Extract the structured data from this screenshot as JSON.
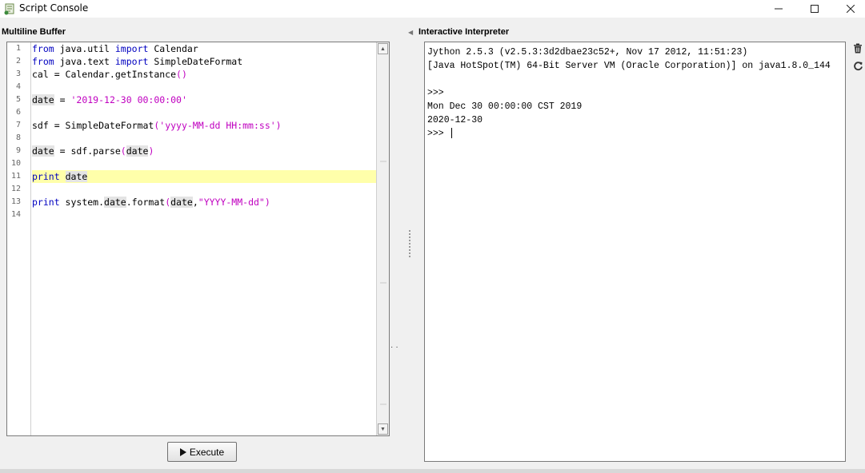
{
  "window": {
    "title": "Script Console",
    "icon": "script-console-icon"
  },
  "left_panel": {
    "header": "Multiline Buffer",
    "execute_label": "Execute",
    "current_line": 11,
    "lines": [
      {
        "num": "1",
        "text": ""
      },
      {
        "num": "2",
        "text": ""
      },
      {
        "num": "3",
        "text": ""
      },
      {
        "num": "4",
        "text": ""
      },
      {
        "num": "5",
        "text": ""
      },
      {
        "num": "6",
        "text": ""
      },
      {
        "num": "7",
        "text": ""
      },
      {
        "num": "8",
        "text": ""
      },
      {
        "num": "9",
        "text": ""
      },
      {
        "num": "10",
        "text": ""
      },
      {
        "num": "11",
        "text": ""
      },
      {
        "num": "12",
        "text": ""
      },
      {
        "num": "13",
        "text": ""
      },
      {
        "num": "14",
        "text": ""
      }
    ],
    "code": {
      "l1_kw1": "from",
      "l1_mod": " java.util ",
      "l1_kw2": "import",
      "l1_name": " Calendar",
      "l2_kw1": "from",
      "l2_mod": " java.text ",
      "l2_kw2": "import",
      "l2_name": " SimpleDateFormat",
      "l3_text": "cal = Calendar.getInstance",
      "l3_paren": "()",
      "l5_var": "date",
      "l5_eq": " = ",
      "l5_str": "'2019-12-30 00:00:00'",
      "l7_text": "sdf = SimpleDateFormat",
      "l7_open": "(",
      "l7_str": "'yyyy-MM-dd HH:mm:ss'",
      "l7_close": ")",
      "l9_var": "date",
      "l9_text": " = sdf.parse",
      "l9_open": "(",
      "l9_arg": "date",
      "l9_close": ")",
      "l11_kw": "print",
      "l11_sp": " ",
      "l11_var": "date",
      "l13_kw": "print",
      "l13_text1": " system.",
      "l13_var1": "date",
      "l13_text2": ".format",
      "l13_open": "(",
      "l13_arg": "date",
      "l13_comma": ",",
      "l13_str": "\"YYYY-MM-dd\"",
      "l13_close": ")"
    }
  },
  "right_panel": {
    "header": "Interactive Interpreter",
    "output": [
      "Jython 2.5.3 (v2.5.3:3d2dbae23c52+, Nov 17 2012, 11:51:23)",
      "[Java HotSpot(TM) 64-Bit Server VM (Oracle Corporation)] on java1.8.0_144",
      "",
      ">>>",
      "Mon Dec 30 00:00:00 CST 2019",
      "2020-12-30",
      ">>> "
    ]
  },
  "colors": {
    "keyword": "#0000c0",
    "string": "#c000c0",
    "current_line_bg": "#ffffaa"
  }
}
